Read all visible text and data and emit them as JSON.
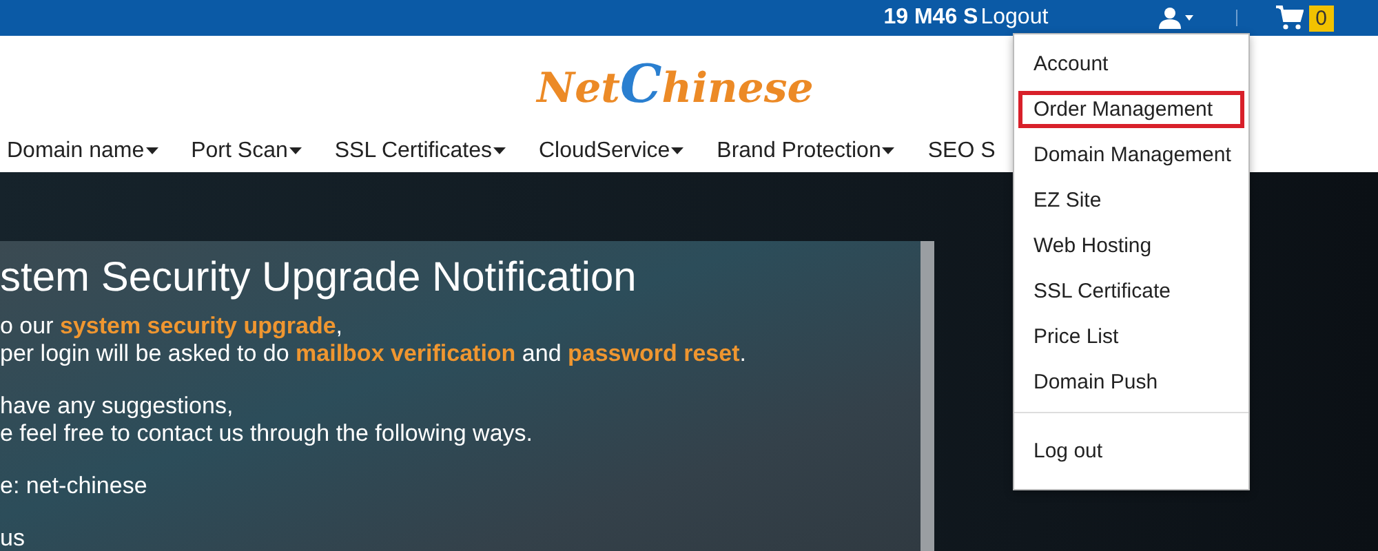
{
  "top_bar": {
    "time": "19 M46 S",
    "logout": "Logout",
    "cart_count": "0"
  },
  "logo": [
    {
      "text": "Net",
      "color": "#ec8a26"
    },
    {
      "text": "C",
      "color": "#2a7fd0"
    },
    {
      "text": "hinese",
      "color": "#ec8a26"
    }
  ],
  "nav": [
    {
      "label": "Domain name",
      "caret": true
    },
    {
      "label": "Port Scan",
      "caret": true
    },
    {
      "label": "SSL Certificates",
      "caret": true
    },
    {
      "label": "CloudService",
      "caret": true
    },
    {
      "label": "Brand Protection",
      "caret": true
    },
    {
      "label": "SEO S",
      "caret": false
    }
  ],
  "notice": {
    "title": "stem Security Upgrade Notification",
    "lines": [
      "o our **system security upgrade**,",
      "per login will be asked to do **mailbox verification** and **password reset**.",
      "have any suggestions,",
      "e feel free to contact us through the following ways.",
      "e: net-chinese",
      "us"
    ]
  },
  "user_menu": {
    "items": [
      {
        "label": "Account",
        "highlighted": false
      },
      {
        "label": "Order Management",
        "highlighted": true
      },
      {
        "label": "Domain Management",
        "highlighted": false
      },
      {
        "label": "EZ Site",
        "highlighted": false
      },
      {
        "label": "Web Hosting",
        "highlighted": false
      },
      {
        "label": "SSL Certificate",
        "highlighted": false
      },
      {
        "label": "Price List",
        "highlighted": false
      },
      {
        "label": "Domain Push",
        "highlighted": false
      }
    ],
    "footer_items": [
      {
        "label": "Log out",
        "highlighted": false
      }
    ]
  }
}
